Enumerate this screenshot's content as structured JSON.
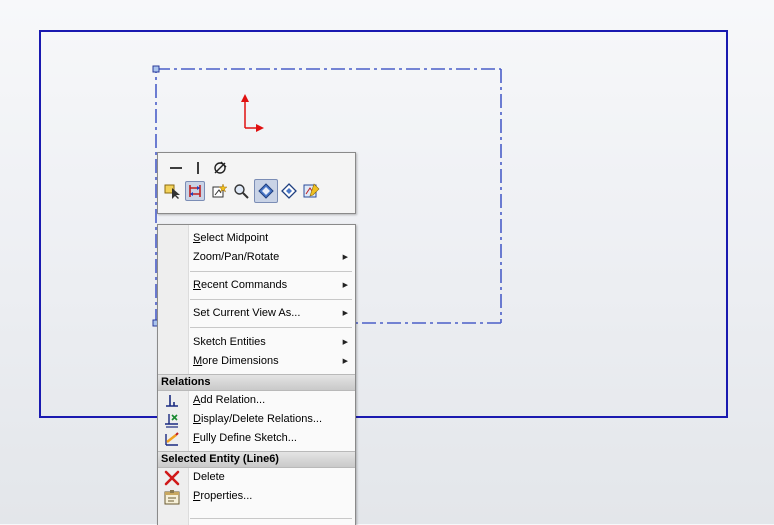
{
  "colors": {
    "sketch_line": "#1a1ab0",
    "centerline": "#4a5ec8",
    "origin": "#e01010",
    "question_mark": "#e01010"
  },
  "annotation": {
    "question_mark": "?"
  },
  "toolbar": {
    "row1": [
      {
        "name": "horizontal-relation-icon",
        "glyph": "—"
      },
      {
        "name": "vertical-relation-icon",
        "glyph": "|"
      },
      {
        "name": "fix-relation-icon",
        "glyph": "⚒"
      }
    ],
    "row2": [
      {
        "name": "select-other-icon"
      },
      {
        "name": "convert-entities-icon",
        "active": true
      },
      {
        "name": "smart-dimension-icon"
      },
      {
        "name": "zoom-to-selection-icon"
      },
      {
        "name": "normal-to-icon",
        "active": true
      },
      {
        "name": "sketch-plane-icon"
      },
      {
        "name": "edit-sketch-icon"
      }
    ]
  },
  "menu": {
    "select_midpoint": {
      "u": "S",
      "rest": "elect Midpoint"
    },
    "zoom_pan_rotate": "Zoom/Pan/Rotate",
    "recent_commands": {
      "u": "R",
      "rest": "ecent Commands"
    },
    "set_current_view": "Set Current View As...",
    "sketch_entities": "Sketch Entities",
    "more_dimensions": {
      "u": "M",
      "rest": "ore Dimensions"
    },
    "relations_header": "Relations",
    "add_relation": {
      "u": "A",
      "rest": "dd Relation..."
    },
    "display_delete_relations": {
      "u": "D",
      "rest": "isplay/Delete Relations..."
    },
    "fully_define_sketch": {
      "u": "F",
      "rest": "ully Define Sketch..."
    },
    "selected_entity_header": "Selected Entity (Line6)",
    "delete": "Delete",
    "properties": {
      "u": "P",
      "rest": "roperties..."
    },
    "submenu_arrow": "▶"
  }
}
